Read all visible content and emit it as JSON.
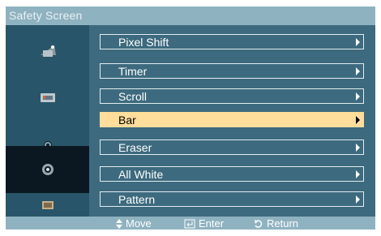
{
  "window": {
    "title": "Safety Screen"
  },
  "sidebar": {
    "items": [
      {
        "icon": "picture-icon",
        "active": false
      },
      {
        "icon": "input-source-icon",
        "active": false
      },
      {
        "icon": "sound-icon",
        "active": false
      },
      {
        "icon": "setup-gear-icon",
        "active": true
      },
      {
        "icon": "multi-control-icon",
        "active": false
      }
    ]
  },
  "menu": {
    "items": [
      {
        "label": "Pixel Shift",
        "selected": false
      },
      {
        "label": "Timer",
        "selected": false
      },
      {
        "label": "Scroll",
        "selected": false
      },
      {
        "label": "Bar",
        "selected": true
      },
      {
        "label": "Eraser",
        "selected": false
      },
      {
        "label": "All White",
        "selected": false
      },
      {
        "label": "Pattern",
        "selected": false
      }
    ]
  },
  "footer": {
    "move_label": "Move",
    "enter_label": "Enter",
    "return_label": "Return"
  },
  "colors": {
    "highlight": "#ffdd9a",
    "panel": "#3d6a7e",
    "bar": "#8fb2c0"
  }
}
